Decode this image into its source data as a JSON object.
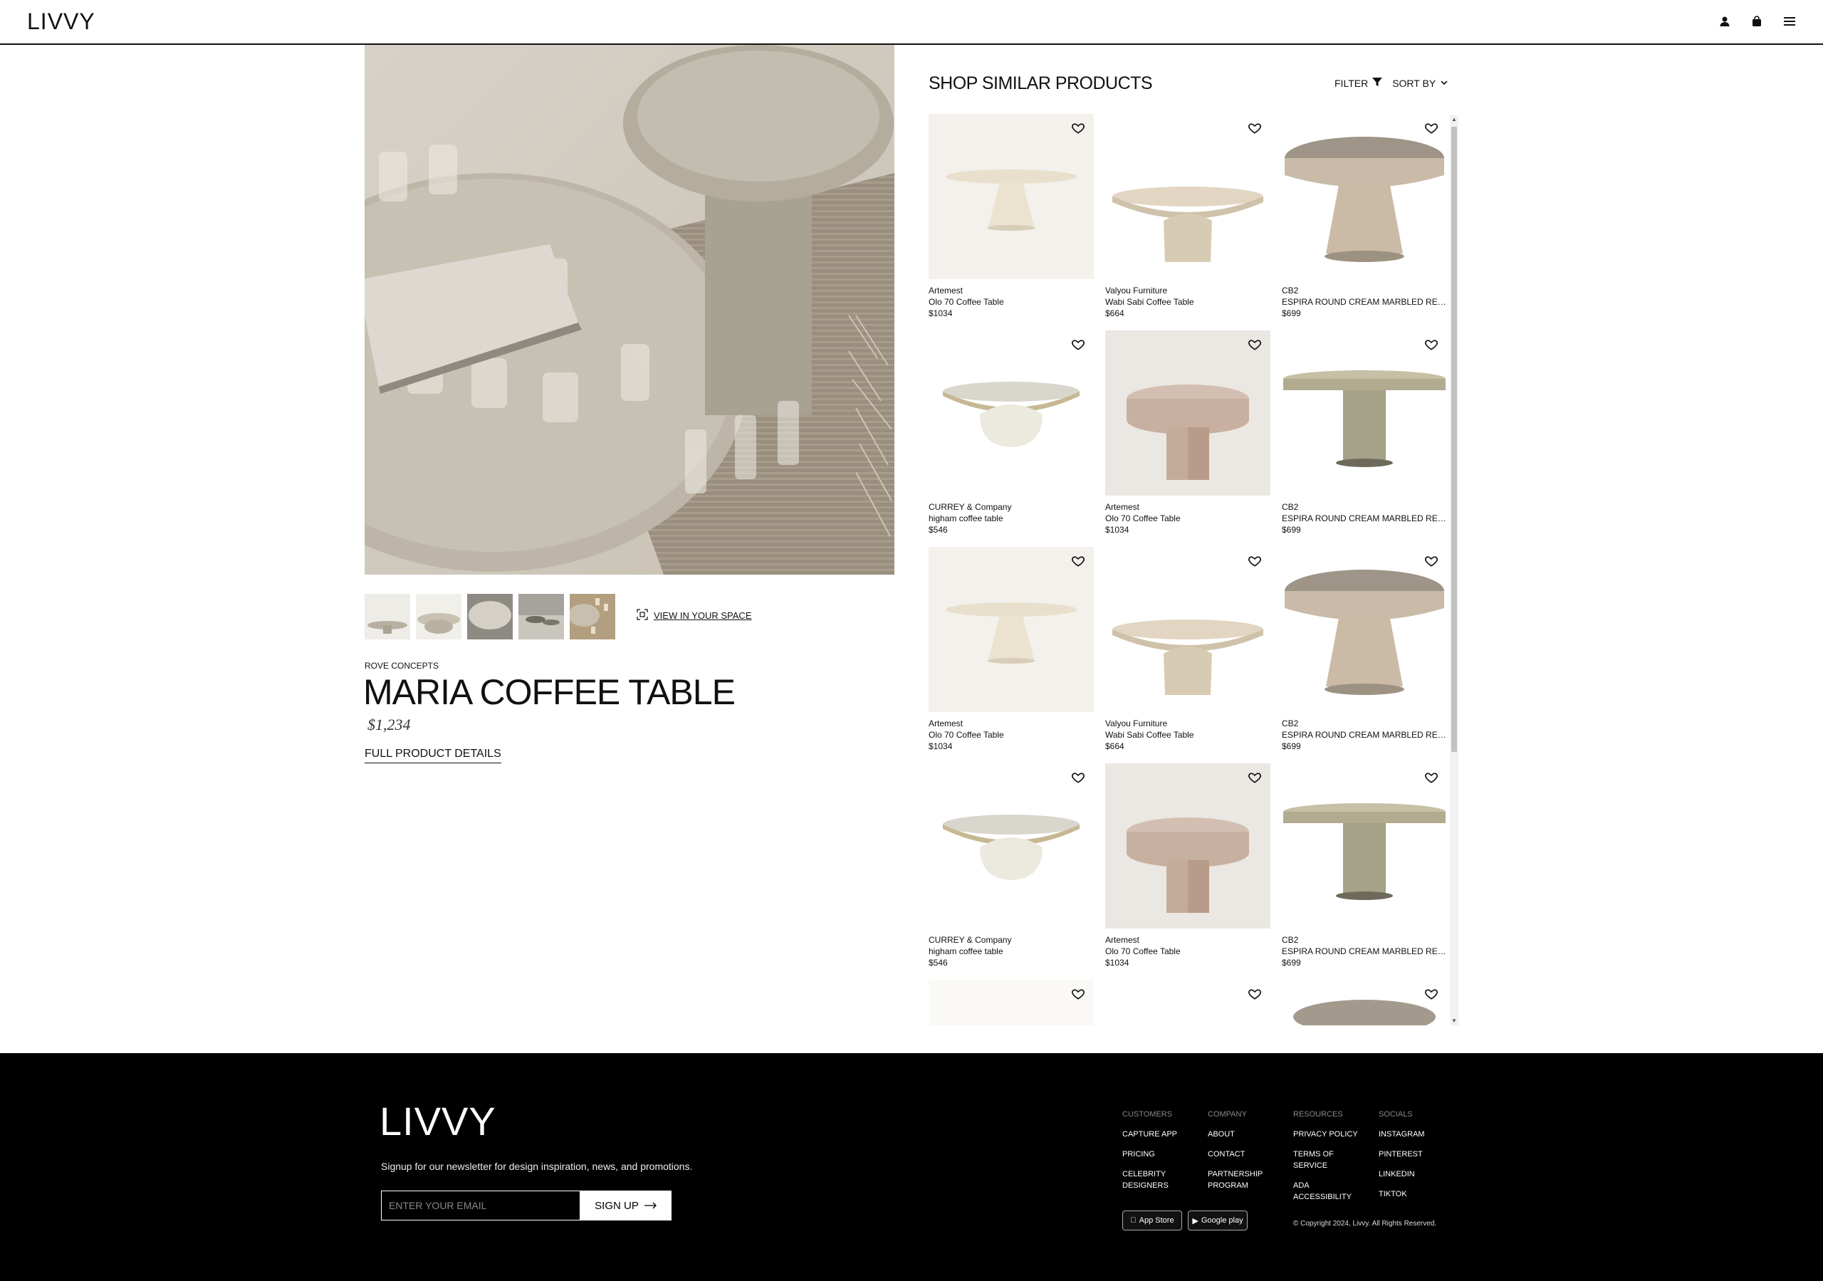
{
  "header": {
    "brand": "LIVVY",
    "icons": [
      "account-icon",
      "bag-icon",
      "menu-icon"
    ]
  },
  "product": {
    "brand": "ROVE CONCEPTS",
    "title": "MARIA COFFEE TABLE",
    "price": "$1,234",
    "full_details": "FULL PRODUCT DETAILS",
    "view_in_space": "VIEW IN YOUR SPACE",
    "thumbnail_count": 5
  },
  "similar": {
    "title": "SHOP SIMILAR PRODUCTS",
    "filter_label": "FILTER",
    "sort_label": "SORT BY",
    "items": [
      {
        "brand": "Artemest",
        "name": "Olo 70 Coffee Table",
        "price": "$1034"
      },
      {
        "brand": "Valyou Furniture",
        "name": "Wabi Sabi Coffee Table",
        "price": "$664"
      },
      {
        "brand": "CB2",
        "name": "ESPIRA ROUND CREAM MARBLED RESIN...",
        "price": "$699"
      },
      {
        "brand": "CURREY & Company",
        "name": "higham coffee table",
        "price": "$546"
      },
      {
        "brand": "Artemest",
        "name": "Olo 70 Coffee Table",
        "price": "$1034"
      },
      {
        "brand": "CB2",
        "name": "ESPIRA ROUND CREAM MARBLED RESIN...",
        "price": "$699"
      },
      {
        "brand": "Artemest",
        "name": "Olo 70 Coffee Table",
        "price": "$1034"
      },
      {
        "brand": "Valyou Furniture",
        "name": "Wabi Sabi Coffee Table",
        "price": "$664"
      },
      {
        "brand": "CB2",
        "name": "ESPIRA ROUND CREAM MARBLED RESIN...",
        "price": "$699"
      },
      {
        "brand": "CURREY & Company",
        "name": "higham coffee table",
        "price": "$546"
      },
      {
        "brand": "Artemest",
        "name": "Olo 70 Coffee Table",
        "price": "$1034"
      },
      {
        "brand": "CB2",
        "name": "ESPIRA ROUND CREAM MARBLED RESIN...",
        "price": "$699"
      }
    ]
  },
  "footer": {
    "brand": "LIVVY",
    "newsletter": "Signup for our newsletter for design inspiration, news, and promotions.",
    "email_placeholder": "ENTER YOUR EMAIL",
    "signup_label": "SIGN UP",
    "columns": [
      {
        "head": "CUSTOMERS",
        "items": [
          "CAPTURE APP",
          "PRICING",
          "CELEBRITY DESIGNERS"
        ]
      },
      {
        "head": "COMPANY",
        "items": [
          "ABOUT",
          "CONTACT",
          "PARTNERSHIP PROGRAM"
        ]
      },
      {
        "head": "RESOURCES",
        "items": [
          "PRIVACY POLICY",
          "TERMS OF SERVICE",
          "ADA ACCESSIBILITY"
        ]
      },
      {
        "head": "SOCIALS",
        "items": [
          "INSTAGRAM",
          "PINTEREST",
          "LINKEDIN",
          "TIKTOK"
        ]
      }
    ],
    "app_store": "App Store",
    "google_play": "Google play",
    "copyright": "© Copyright 2024, Livvy. All Rights Reserved."
  }
}
